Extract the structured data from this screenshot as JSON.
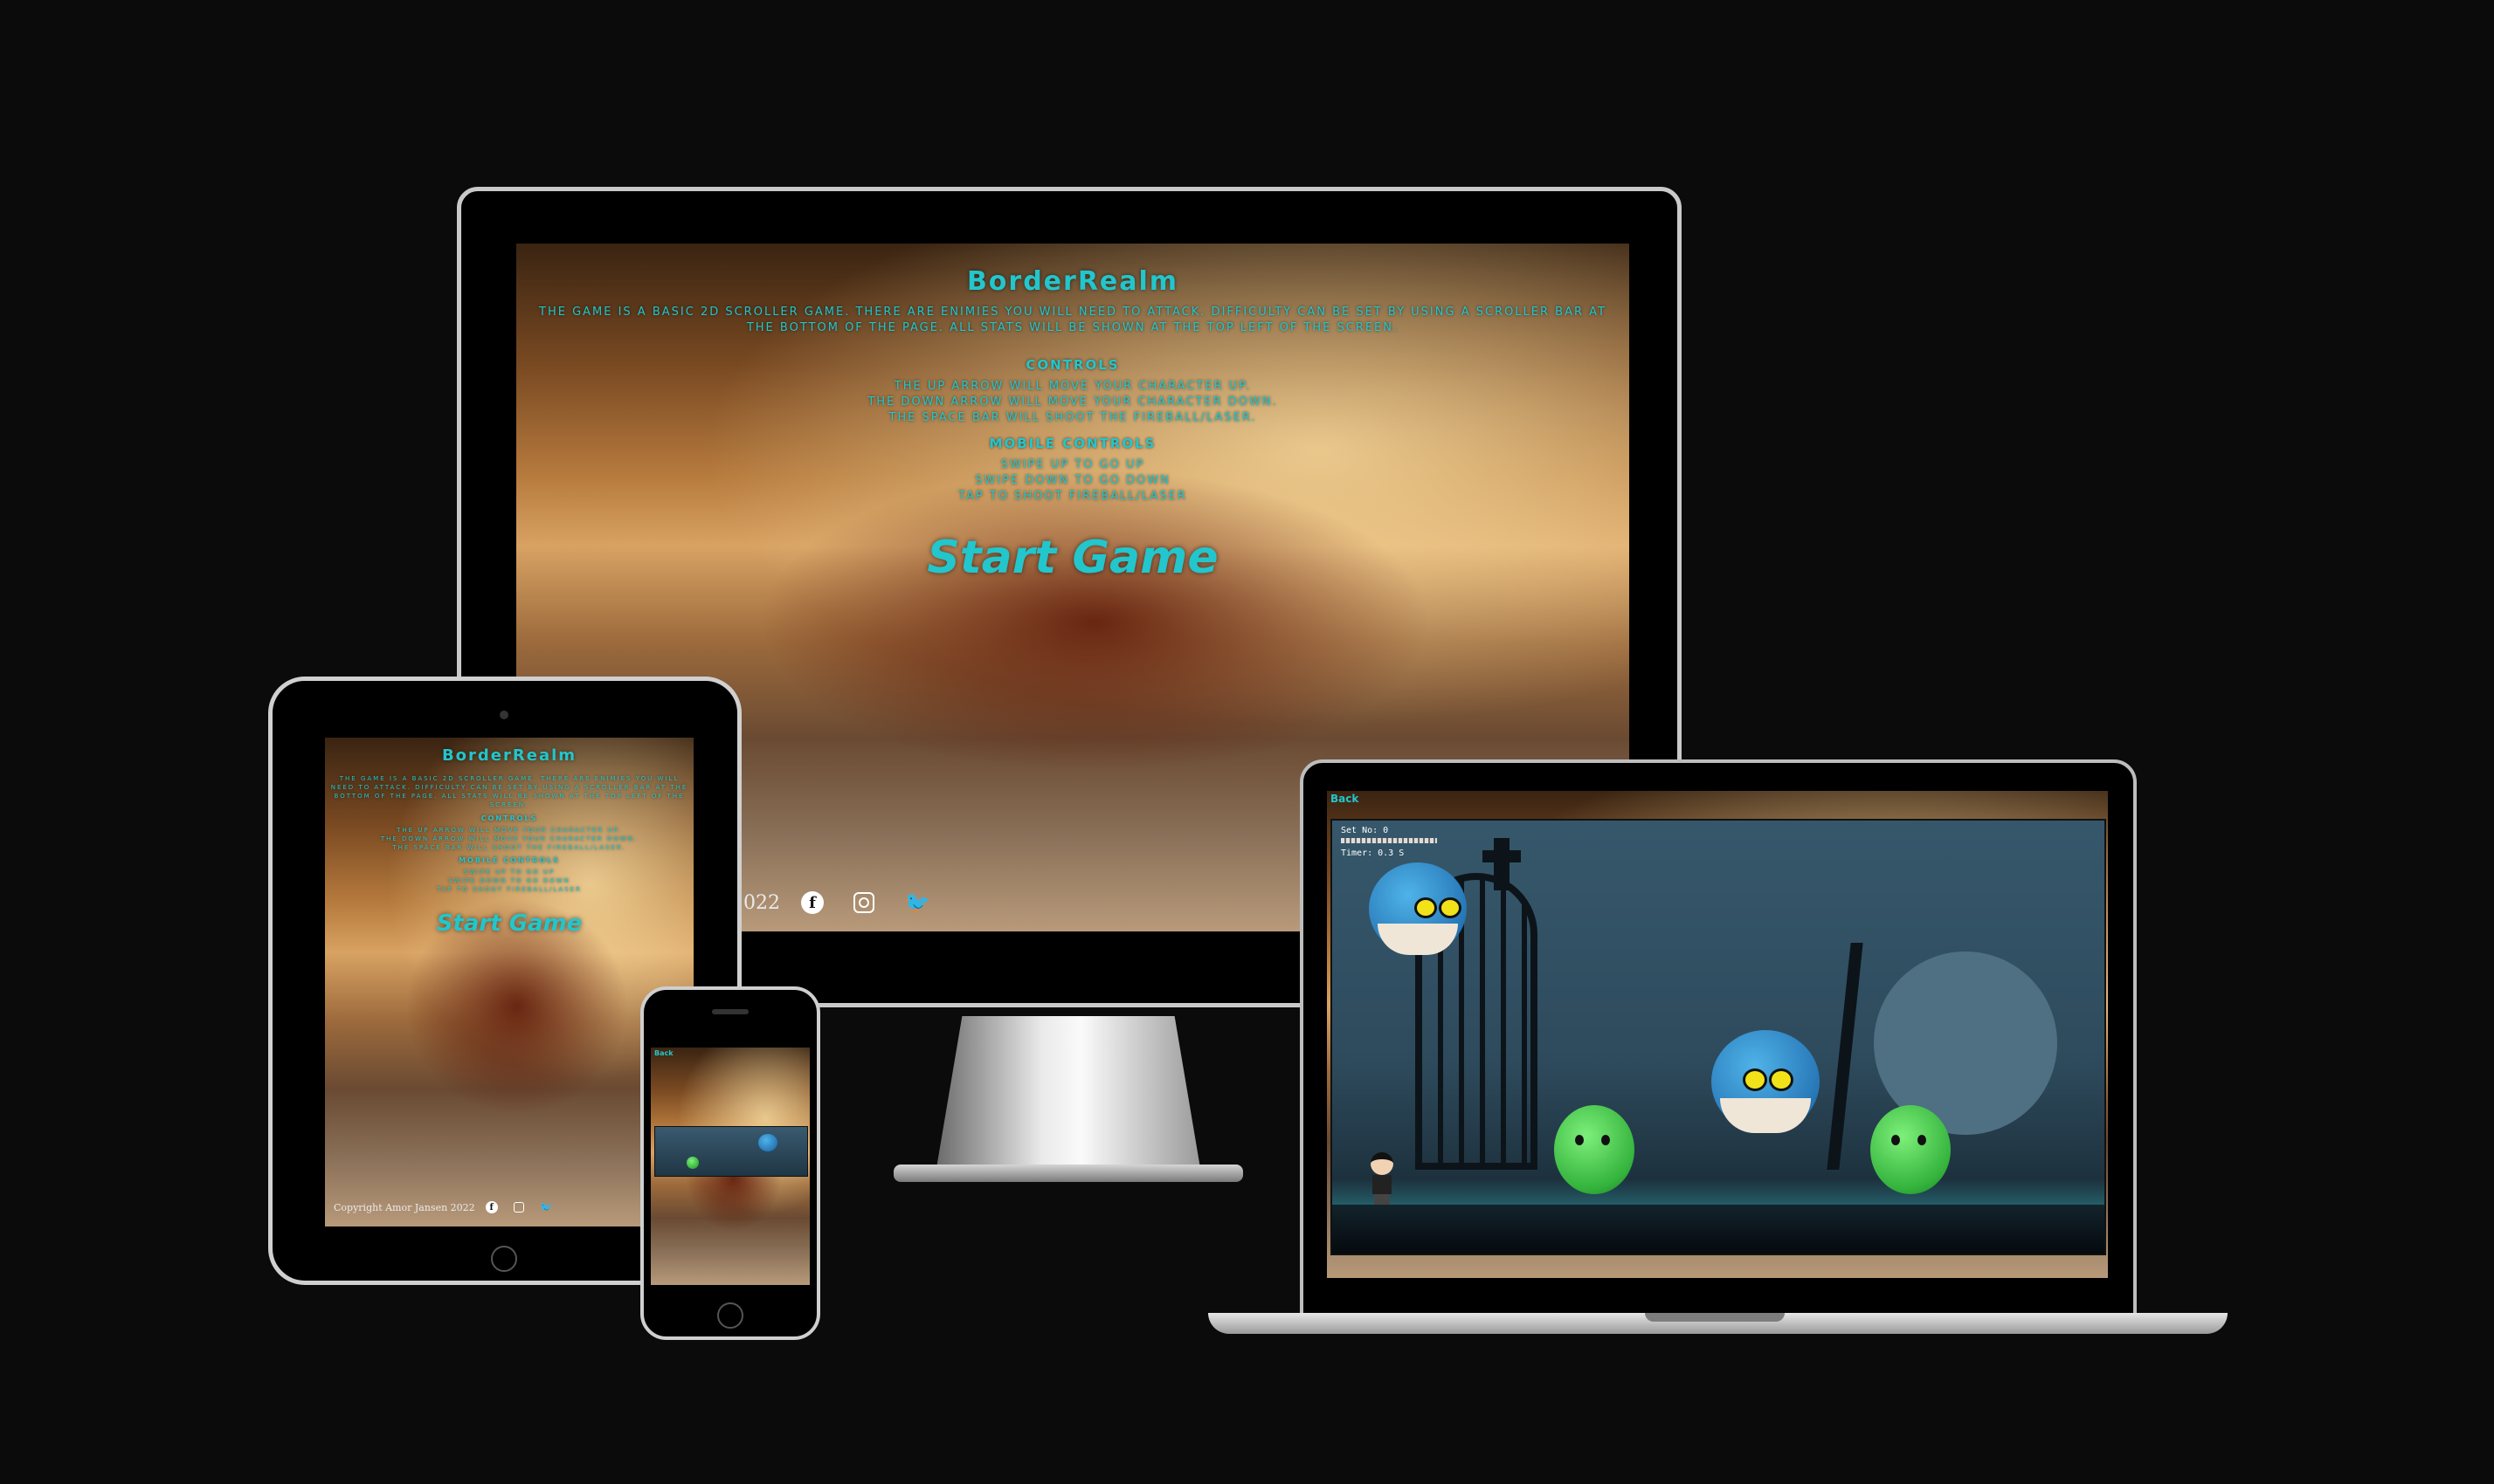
{
  "game": {
    "title": "BorderRealm",
    "intro": "THE GAME IS A BASIC 2D SCROLLER GAME. THERE ARE ENIMIES YOU WILL NEED TO ATTACK. DIFFICULTY CAN BE SET BY USING A SCROLLER BAR AT THE BOTTOM OF THE PAGE. ALL STATS WILL BE SHOWN AT THE TOP LEFT OF THE SCREEN.",
    "controls_heading": "CONTROLS",
    "controls": [
      "THE UP ARROW WILL MOVE YOUR CHARACTER UP.",
      "THE DOWN ARROW WILL MOVE YOUR CHARACTER DOWN.",
      "THE SPACE BAR WILL SHOOT THE FIREBALL/LASER."
    ],
    "mobile_heading": "MOBILE CONTROLS",
    "mobile_controls": [
      "SWIPE UP TO GO UP",
      "SWIPE DOWN TO GO DOWN",
      "TAP TO SHOOT FIREBALL/LASER"
    ],
    "start_label": "Start Game"
  },
  "footer": {
    "copyright": "Copyright Amor Jansen 2022",
    "copyright_partial": "022",
    "social_icons": [
      "facebook-icon",
      "instagram-icon",
      "twitter-icon"
    ]
  },
  "play_screen": {
    "back_label": "Back",
    "stats_label": "Set No: 0",
    "timer_label": "Timer: 0.3 S"
  },
  "colors": {
    "accent": "#22c6cc",
    "background": "#0b0b0c",
    "game_sky": "#2d4a5c"
  }
}
